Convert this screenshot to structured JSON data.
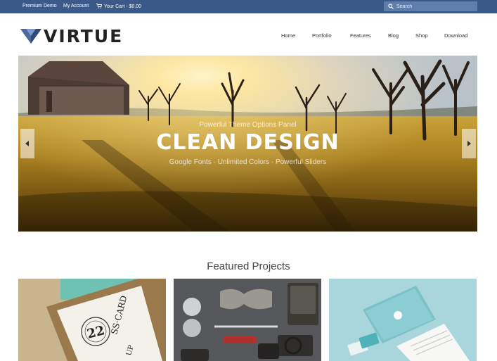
{
  "topbar": {
    "premium_demo": "Premium Demo",
    "my_account": "My Account",
    "cart": "Your Cart - $0.00",
    "search_placeholder": "Search"
  },
  "logo": {
    "text": "VIRTUE"
  },
  "nav": {
    "items": [
      "Home",
      "Portfolio",
      "Features",
      "Blog",
      "Shop",
      "Download"
    ]
  },
  "slider": {
    "kicker": "Powerful Theme Options Panel",
    "title": "CLEAN DESIGN",
    "subtitle": "Google Fonts · Unlimited Colors · Powerful Sliders"
  },
  "featured": {
    "title": "Featured Projects",
    "card_text": {
      "number": "22",
      "word": "SS·CARD",
      "letter": "UP"
    }
  },
  "colors": {
    "topbar": "#3b5a8a",
    "search_bg": "#5f7ea9",
    "logo_mark": "#2f4a7a"
  }
}
